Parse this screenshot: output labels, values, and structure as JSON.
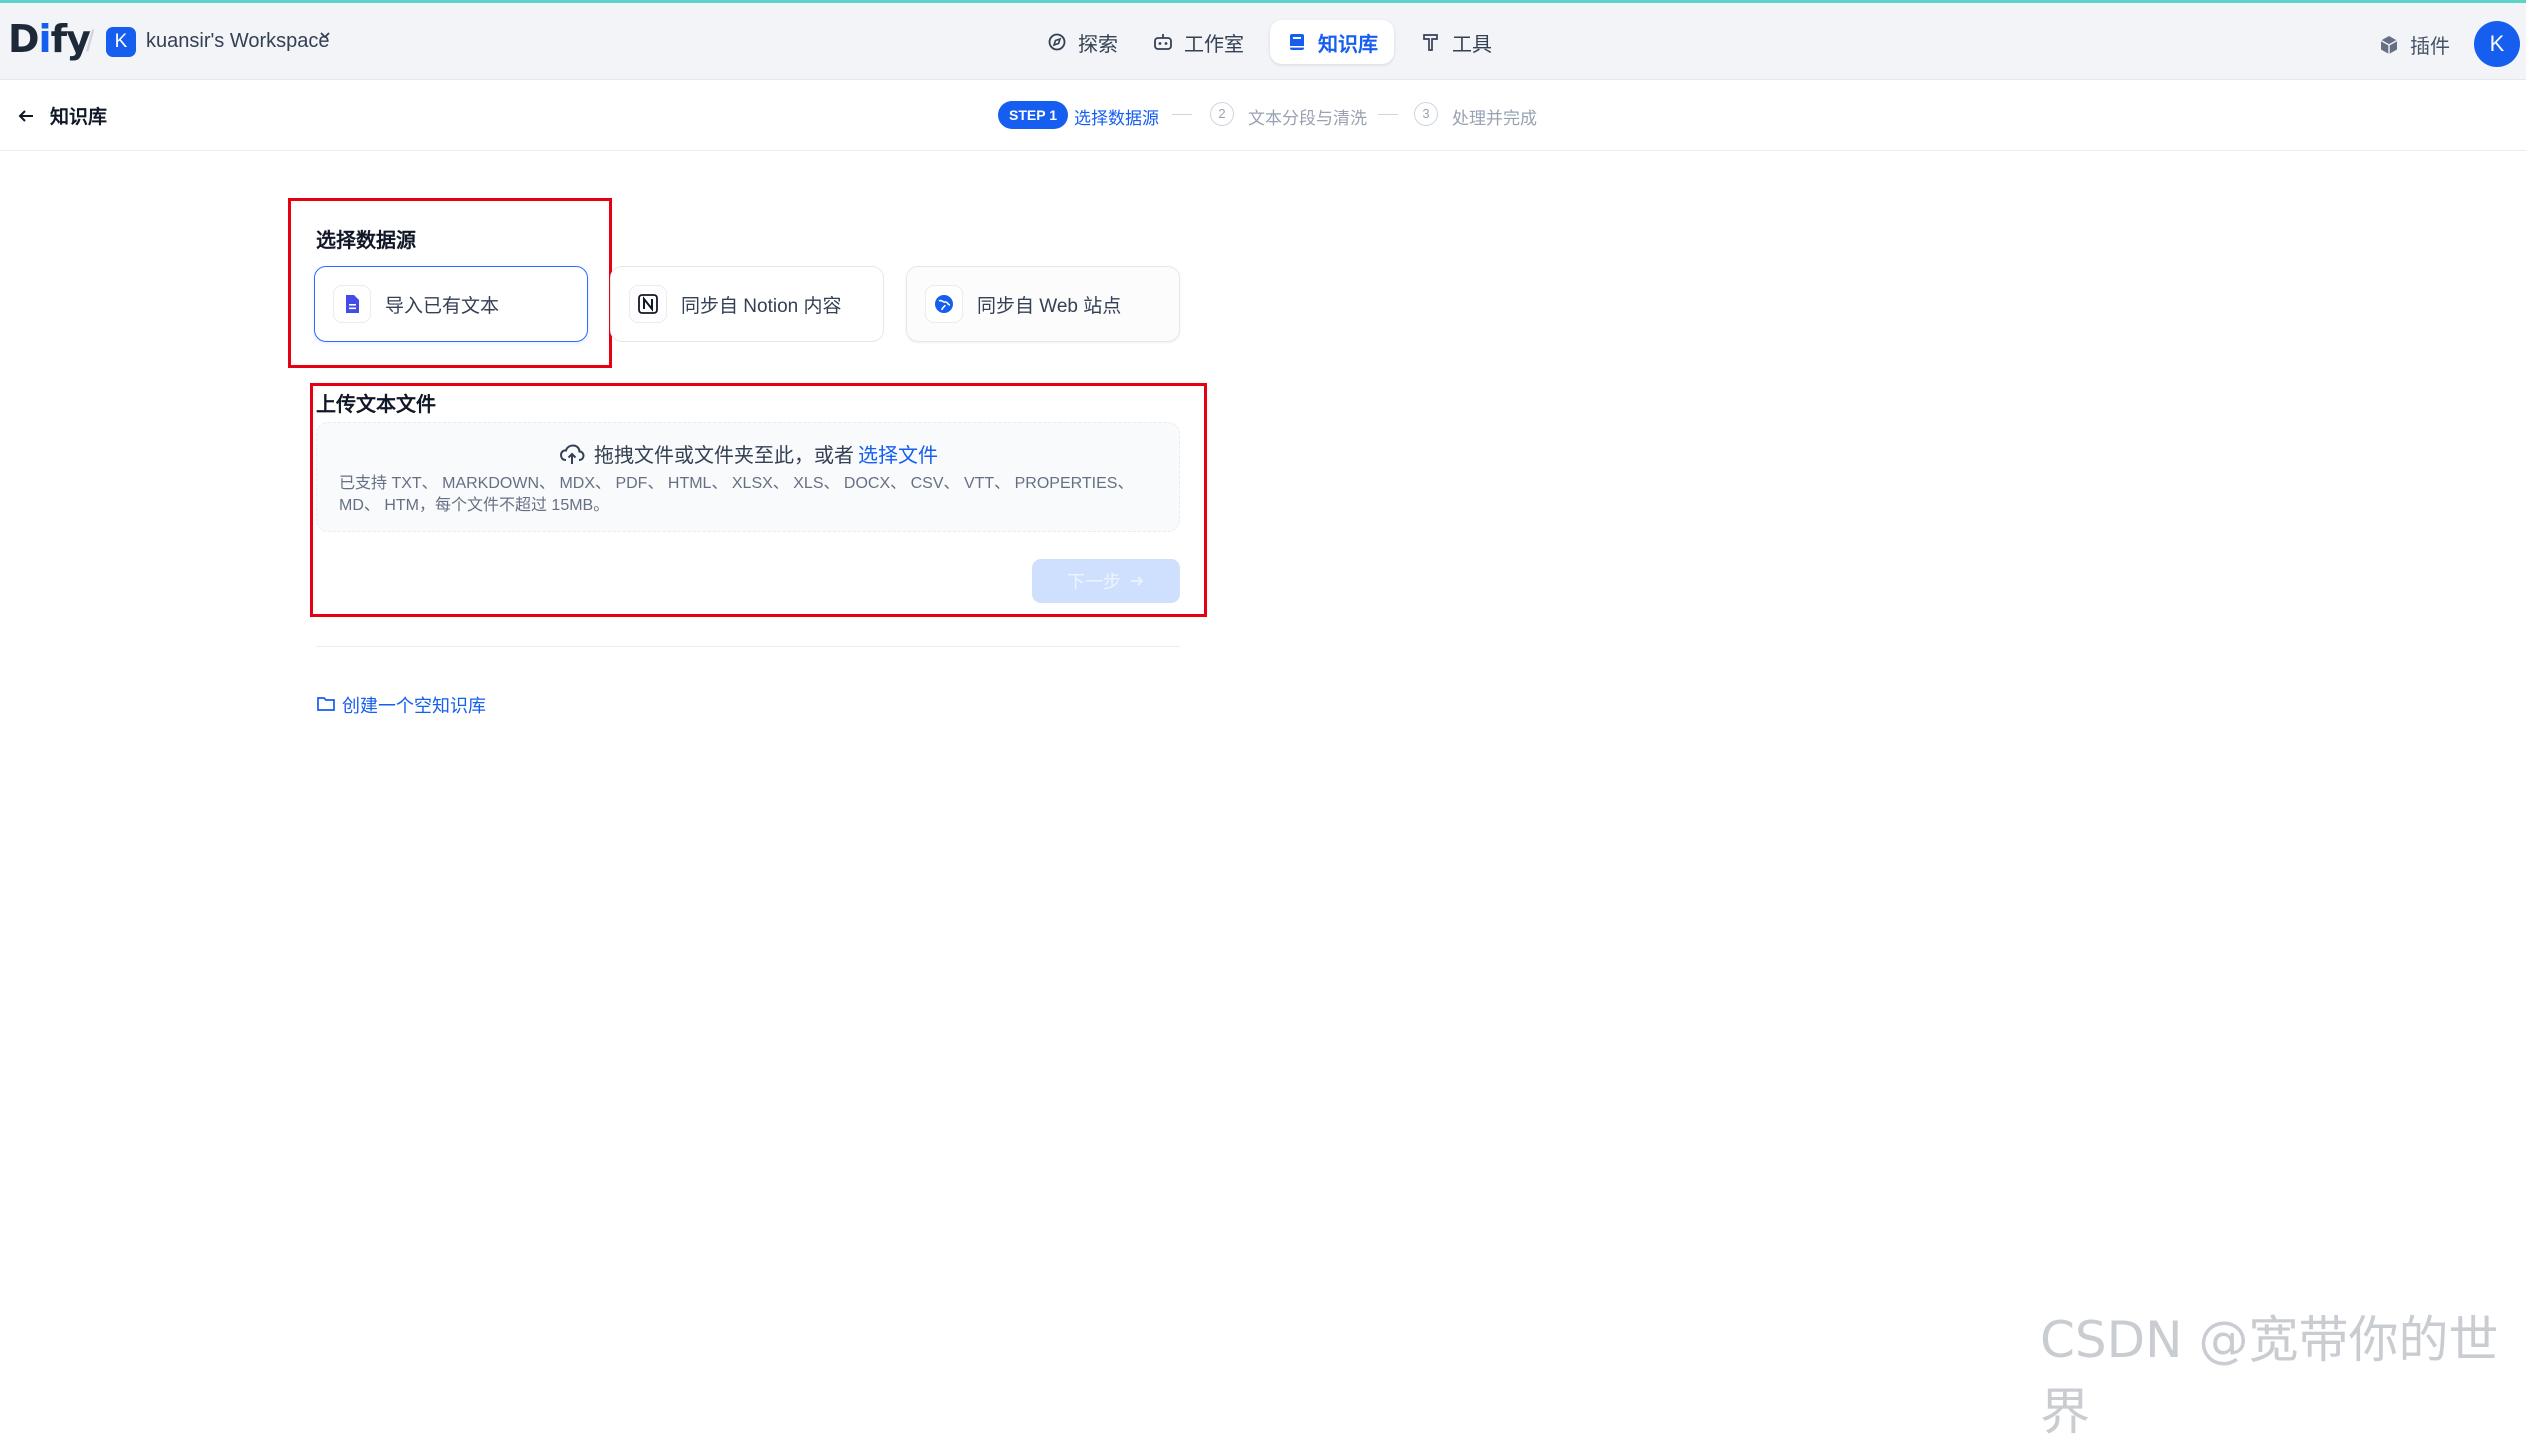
{
  "app": {
    "logo_prefix": "D",
    "logo_i": "i",
    "logo_suffix": "fy",
    "workspace_initial": "K",
    "workspace_name": "kuansir's Workspace",
    "user_initial": "K"
  },
  "nav": {
    "explore": "探索",
    "studio": "工作室",
    "knowledge": "知识库",
    "tools": "工具",
    "plugins": "插件",
    "active": "knowledge"
  },
  "subheader": {
    "back_label": "知识库",
    "steps": [
      {
        "badge": "STEP 1",
        "label": "选择数据源",
        "state": "active"
      },
      {
        "num": "2",
        "label": "文本分段与清洗",
        "state": "pending"
      },
      {
        "num": "3",
        "label": "处理并完成",
        "state": "pending"
      }
    ]
  },
  "datasource": {
    "title": "选择数据源",
    "options": [
      {
        "label": "导入已有文本",
        "icon": "file-text-icon",
        "selected": true
      },
      {
        "label": "同步自 Notion 内容",
        "icon": "notion-icon",
        "selected": false
      },
      {
        "label": "同步自 Web 站点",
        "icon": "globe-icon",
        "selected": false
      }
    ]
  },
  "upload": {
    "title": "上传文本文件",
    "drop_text": "拖拽文件或文件夹至此，或者",
    "select_link": "选择文件",
    "tip_line1": "已支持 TXT、 MARKDOWN、 MDX、 PDF、 HTML、 XLSX、 XLS、 DOCX、 CSV、 VTT、 PROPERTIES、",
    "tip_line2": "MD、 HTM，每个文件不超过 15MB。",
    "next_button": "下一步",
    "next_disabled": true
  },
  "create_empty": "创建一个空知识库",
  "watermark": "CSDN @宽带你的世界",
  "colors": {
    "accent": "#155eef",
    "highlight_box": "#e60012",
    "topline": "#5ed3c9"
  }
}
